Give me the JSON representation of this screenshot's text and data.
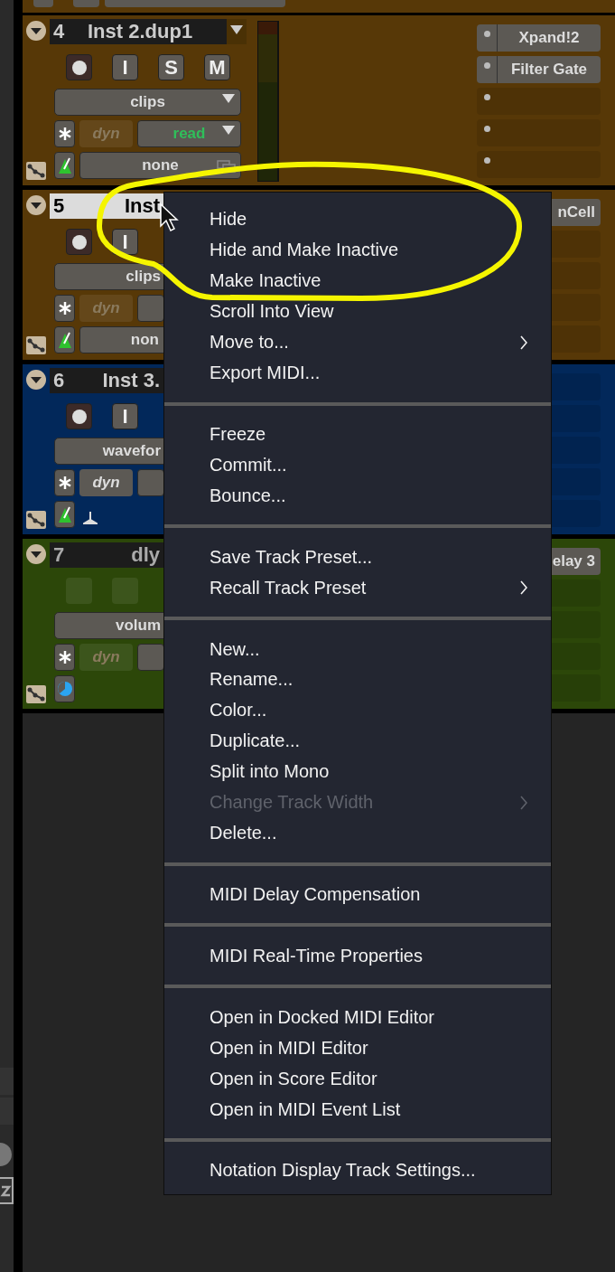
{
  "tracks": [
    {
      "number": "4",
      "name": "Inst 2.dup1",
      "kind": "instrument",
      "color": "#573807",
      "selected": false,
      "buttons": [
        "I",
        "S",
        "M"
      ],
      "view": "clips",
      "dyn": {
        "label": "dyn",
        "on": false
      },
      "automation": "read",
      "group": "none",
      "inserts": [
        {
          "kind": "plugin",
          "name": "Xpand!2"
        },
        {
          "kind": "plugin",
          "name": "Filter Gate"
        },
        {
          "kind": "empty"
        },
        {
          "kind": "empty"
        },
        {
          "kind": "empty"
        }
      ]
    },
    {
      "number": "5",
      "name": "Inst",
      "kind": "instrument",
      "color": "#573807",
      "selected": true,
      "buttons": [
        "I"
      ],
      "view": "clips",
      "dyn": {
        "label": "dyn",
        "on": false
      },
      "group": "non",
      "inserts": [
        {
          "kind": "plugin",
          "name": "nCell"
        },
        {
          "kind": "empty"
        },
        {
          "kind": "empty"
        },
        {
          "kind": "empty"
        },
        {
          "kind": "empty"
        }
      ]
    },
    {
      "number": "6",
      "name": "Inst 3.",
      "kind": "instrument",
      "color": "#02285a",
      "selected": false,
      "buttons": [
        "I"
      ],
      "view": "wavefor",
      "dyn": {
        "label": "dyn",
        "on": true
      },
      "inserts": [
        {
          "kind": "empty"
        },
        {
          "kind": "empty"
        },
        {
          "kind": "empty"
        },
        {
          "kind": "empty"
        },
        {
          "kind": "empty"
        }
      ]
    },
    {
      "number": "7",
      "name": "dly",
      "kind": "aux",
      "color": "#2c4709",
      "selected": false,
      "view": "volum",
      "dyn": {
        "label": "dyn",
        "on": false
      },
      "inserts": [
        {
          "kind": "plugin",
          "name": "elay 3"
        },
        {
          "kind": "empty"
        },
        {
          "kind": "empty"
        },
        {
          "kind": "empty"
        },
        {
          "kind": "empty"
        }
      ]
    }
  ],
  "context_menu": {
    "groups": [
      {
        "items": [
          {
            "label": "Hide",
            "disabled": false
          },
          {
            "label": "Hide and Make Inactive",
            "disabled": false
          },
          {
            "label": "Make Inactive",
            "disabled": false
          },
          {
            "label": "Scroll Into View",
            "disabled": false
          },
          {
            "label": "Move to...",
            "disabled": false,
            "submenu": true
          },
          {
            "label": "Export MIDI...",
            "disabled": false
          }
        ]
      },
      {
        "items": [
          {
            "label": "Freeze",
            "disabled": false
          },
          {
            "label": "Commit...",
            "disabled": false
          },
          {
            "label": "Bounce...",
            "disabled": false
          }
        ]
      },
      {
        "items": [
          {
            "label": "Save Track Preset...",
            "disabled": false
          },
          {
            "label": "Recall Track Preset",
            "disabled": false,
            "submenu": true
          }
        ]
      },
      {
        "items": [
          {
            "label": "New...",
            "disabled": false
          },
          {
            "label": "Rename...",
            "disabled": false
          },
          {
            "label": "Color...",
            "disabled": false
          },
          {
            "label": "Duplicate...",
            "disabled": false
          },
          {
            "label": "Split into Mono",
            "disabled": false
          },
          {
            "label": "Change Track Width",
            "disabled": true,
            "submenu": true
          },
          {
            "label": "Delete...",
            "disabled": false
          }
        ]
      },
      {
        "items": [
          {
            "label": "MIDI Delay Compensation",
            "disabled": false
          }
        ]
      },
      {
        "items": [
          {
            "label": "MIDI Real-Time Properties",
            "disabled": false
          }
        ]
      },
      {
        "items": [
          {
            "label": "Open in Docked MIDI Editor",
            "disabled": false
          },
          {
            "label": "Open in MIDI Editor",
            "disabled": false
          },
          {
            "label": "Open in Score Editor",
            "disabled": false
          },
          {
            "label": "Open in MIDI Event List",
            "disabled": false
          }
        ]
      },
      {
        "items": [
          {
            "label": "Notation Display Track Settings...",
            "disabled": false
          }
        ]
      }
    ]
  }
}
